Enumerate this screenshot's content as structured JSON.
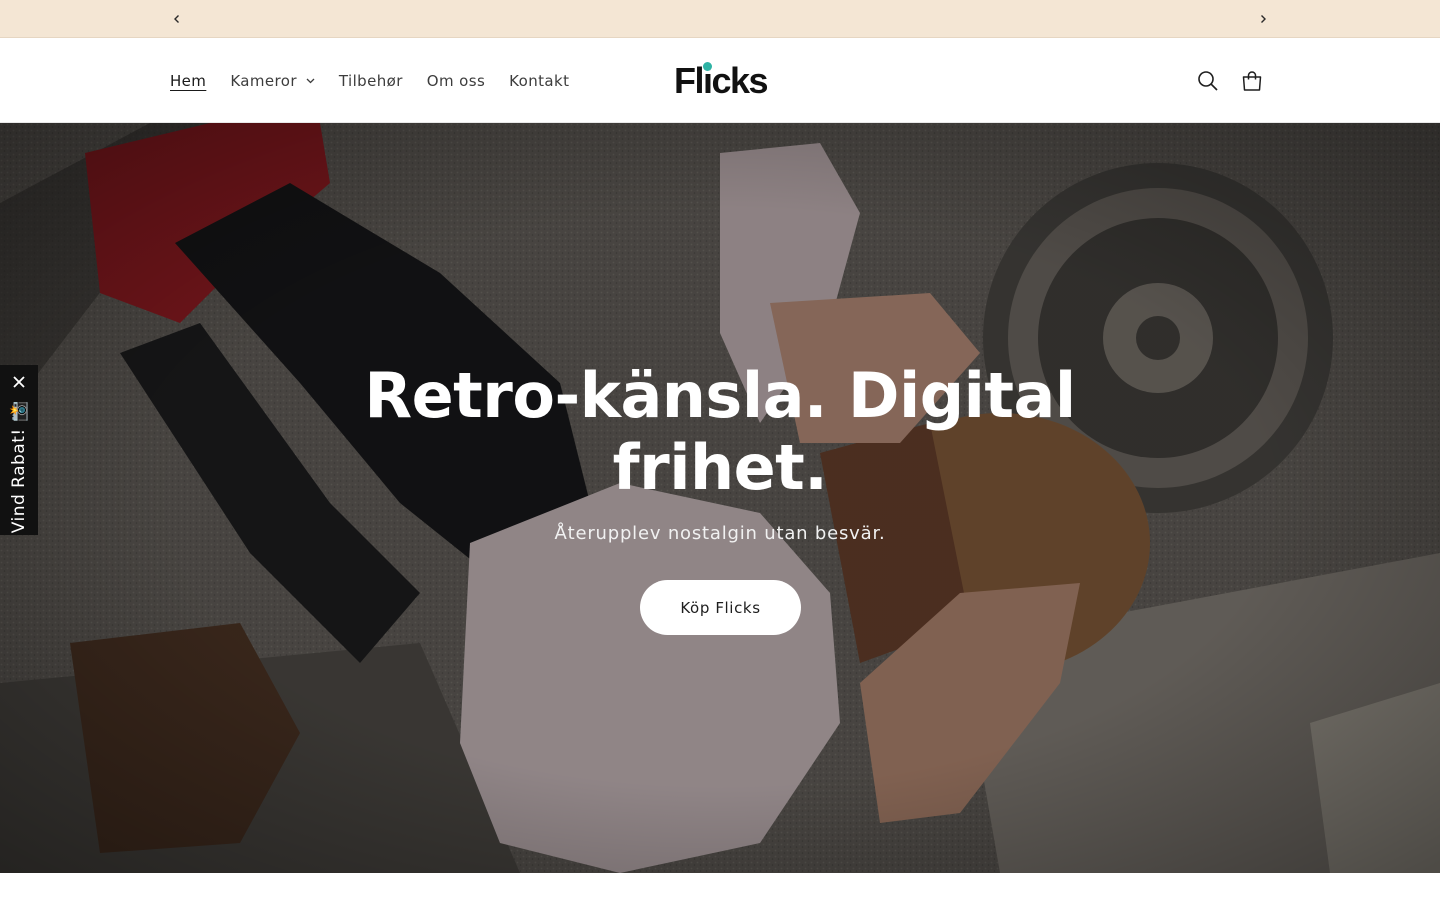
{
  "announcement": {
    "prev_icon": "chevron-left-icon",
    "next_icon": "chevron-right-icon",
    "background": "#f4e6d4"
  },
  "header": {
    "nav": [
      {
        "label": "Hem",
        "active": true
      },
      {
        "label": "Kameror",
        "has_dropdown": true
      },
      {
        "label": "Tilbehør"
      },
      {
        "label": "Om oss"
      },
      {
        "label": "Kontakt"
      }
    ],
    "logo": {
      "text_pre": "Fl",
      "text_i": "i",
      "text_post": "cks",
      "dot_color": "#2fb3a5"
    },
    "icons": [
      "search-icon",
      "cart-icon"
    ]
  },
  "hero": {
    "title": "Retro-känsla. Digital frihet.",
    "subtitle": "Återupplev nostalgin utan besvär.",
    "cta": "Köp Flicks"
  },
  "side_tab": {
    "label": "Vind Rabat! 📸",
    "close_icon": "close-icon"
  }
}
